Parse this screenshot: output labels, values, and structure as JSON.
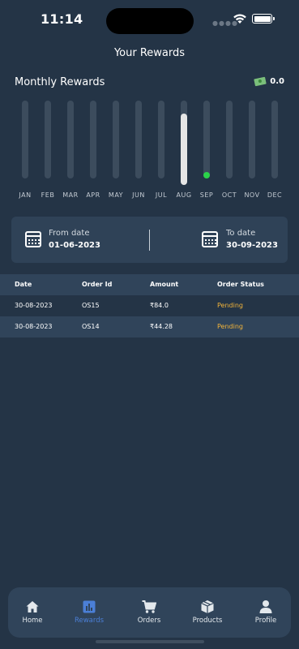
{
  "status_bar": {
    "time": "11:14"
  },
  "header": {
    "title": "Your Rewards"
  },
  "monthly": {
    "title": "Monthly Rewards",
    "total": "0.0",
    "months": [
      {
        "label": "JAN",
        "value": 0
      },
      {
        "label": "FEB",
        "value": 0
      },
      {
        "label": "MAR",
        "value": 0
      },
      {
        "label": "APR",
        "value": 0
      },
      {
        "label": "MAY",
        "value": 0
      },
      {
        "label": "JUN",
        "value": 0
      },
      {
        "label": "JUL",
        "value": 0
      },
      {
        "label": "AUG",
        "value": 1
      },
      {
        "label": "SEP",
        "value": 0
      },
      {
        "label": "OCT",
        "value": 0
      },
      {
        "label": "NOV",
        "value": 0
      },
      {
        "label": "DEC",
        "value": 0
      }
    ],
    "selected_month": "SEP",
    "colors": {
      "track": "#3c4c5d",
      "fill": "#e6e6e6",
      "marker": "#2bd24a"
    }
  },
  "date_range": {
    "from_label": "From date",
    "from_value": "01-06-2023",
    "to_label": "To date",
    "to_value": "30-09-2023"
  },
  "orders": {
    "columns": [
      "Date",
      "Order Id",
      "Amount",
      "Order Status"
    ],
    "rows": [
      {
        "date": "30-08-2023",
        "order_id": "OS15",
        "amount": "₹84.0",
        "status": "Pending"
      },
      {
        "date": "30-08-2023",
        "order_id": "OS14",
        "amount": "₹44.28",
        "status": "Pending"
      }
    ],
    "status_color": "#f0b23a"
  },
  "nav": {
    "active": "Rewards",
    "active_color": "#4b7fd6",
    "items": [
      {
        "label": "Home",
        "icon": "home-icon"
      },
      {
        "label": "Rewards",
        "icon": "chart-icon"
      },
      {
        "label": "Orders",
        "icon": "cart-icon"
      },
      {
        "label": "Products",
        "icon": "box-icon"
      },
      {
        "label": "Profile",
        "icon": "person-icon"
      }
    ]
  }
}
